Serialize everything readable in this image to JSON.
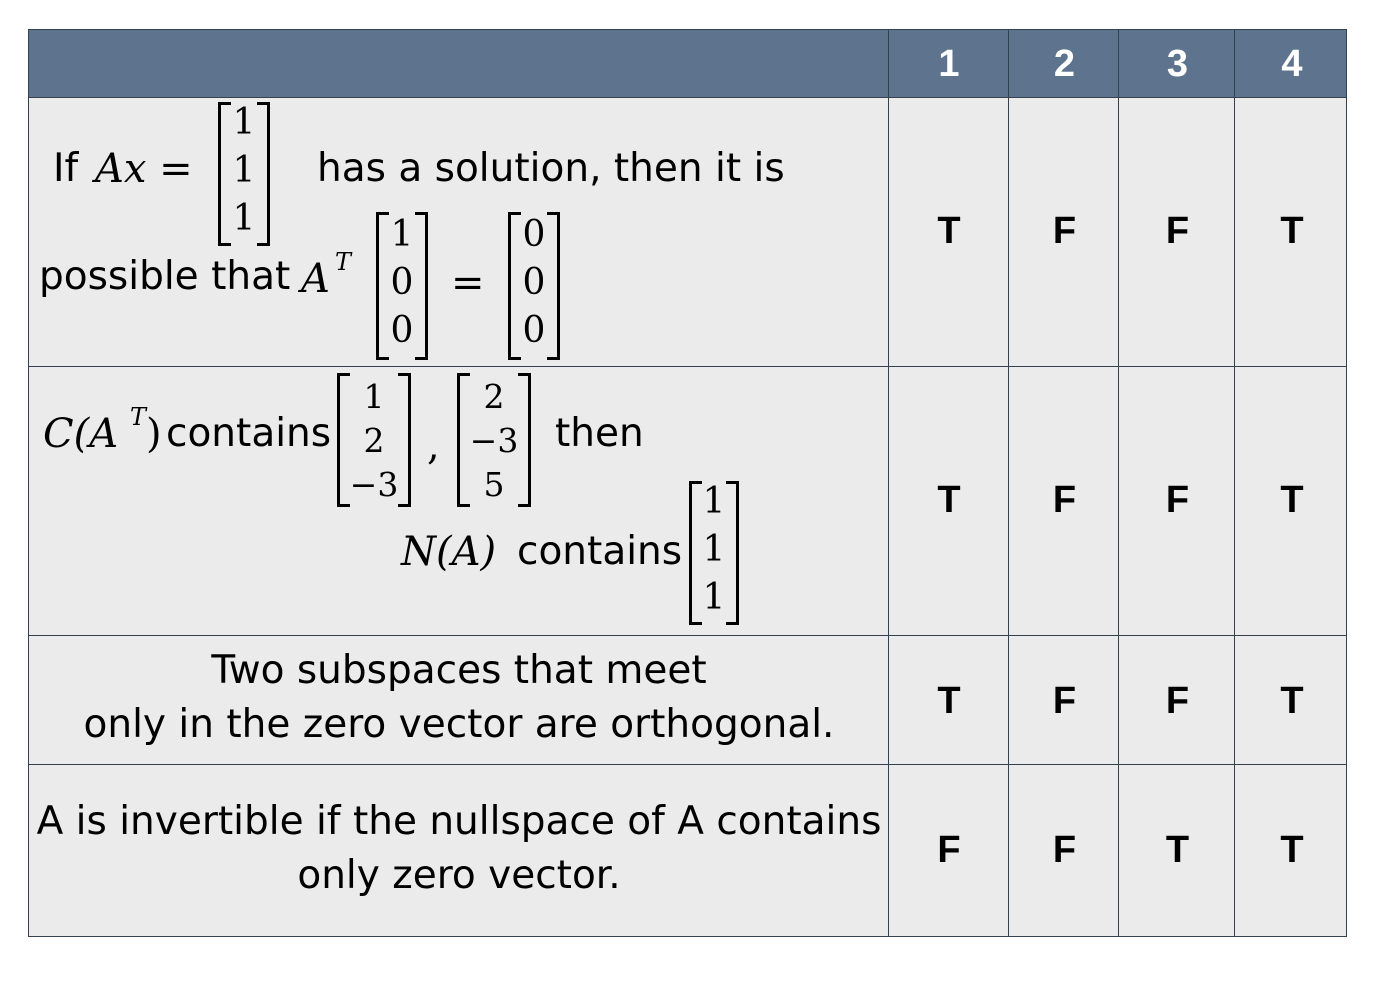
{
  "columns": [
    "1",
    "2",
    "3",
    "4"
  ],
  "rows": [
    {
      "statement": {
        "part1": "If",
        "math1": "Ax =",
        "vec_b": [
          "1",
          "1",
          "1"
        ],
        "part2": "has a solution, then it is",
        "part3": "possible that",
        "math2": "A",
        "sup": "T",
        "vec_x": [
          "1",
          "0",
          "0"
        ],
        "eq": "=",
        "vec_zero": [
          "0",
          "0",
          "0"
        ]
      },
      "answers": [
        "T",
        "F",
        "F",
        "T"
      ]
    },
    {
      "statement": {
        "math1": "C(A",
        "sup": "T",
        "math1_close": ")",
        "part1": "contains",
        "vec_a": [
          "1",
          "2",
          "−3"
        ],
        "comma": ",",
        "vec_b": [
          "2",
          "−3",
          "5"
        ],
        "part2": "then",
        "math2": "N(A)",
        "part3": "contains",
        "vec_c": [
          "1",
          "1",
          "1"
        ]
      },
      "answers": [
        "T",
        "F",
        "F",
        "T"
      ]
    },
    {
      "statement": {
        "line1": "Two subspaces that meet",
        "line2": "only in the zero vector are orthogonal."
      },
      "answers": [
        "T",
        "F",
        "F",
        "T"
      ]
    },
    {
      "statement": {
        "line1": "A is invertible if the nullspace of A contains",
        "line2": "only zero vector."
      },
      "answers": [
        "F",
        "F",
        "T",
        "T"
      ]
    }
  ]
}
